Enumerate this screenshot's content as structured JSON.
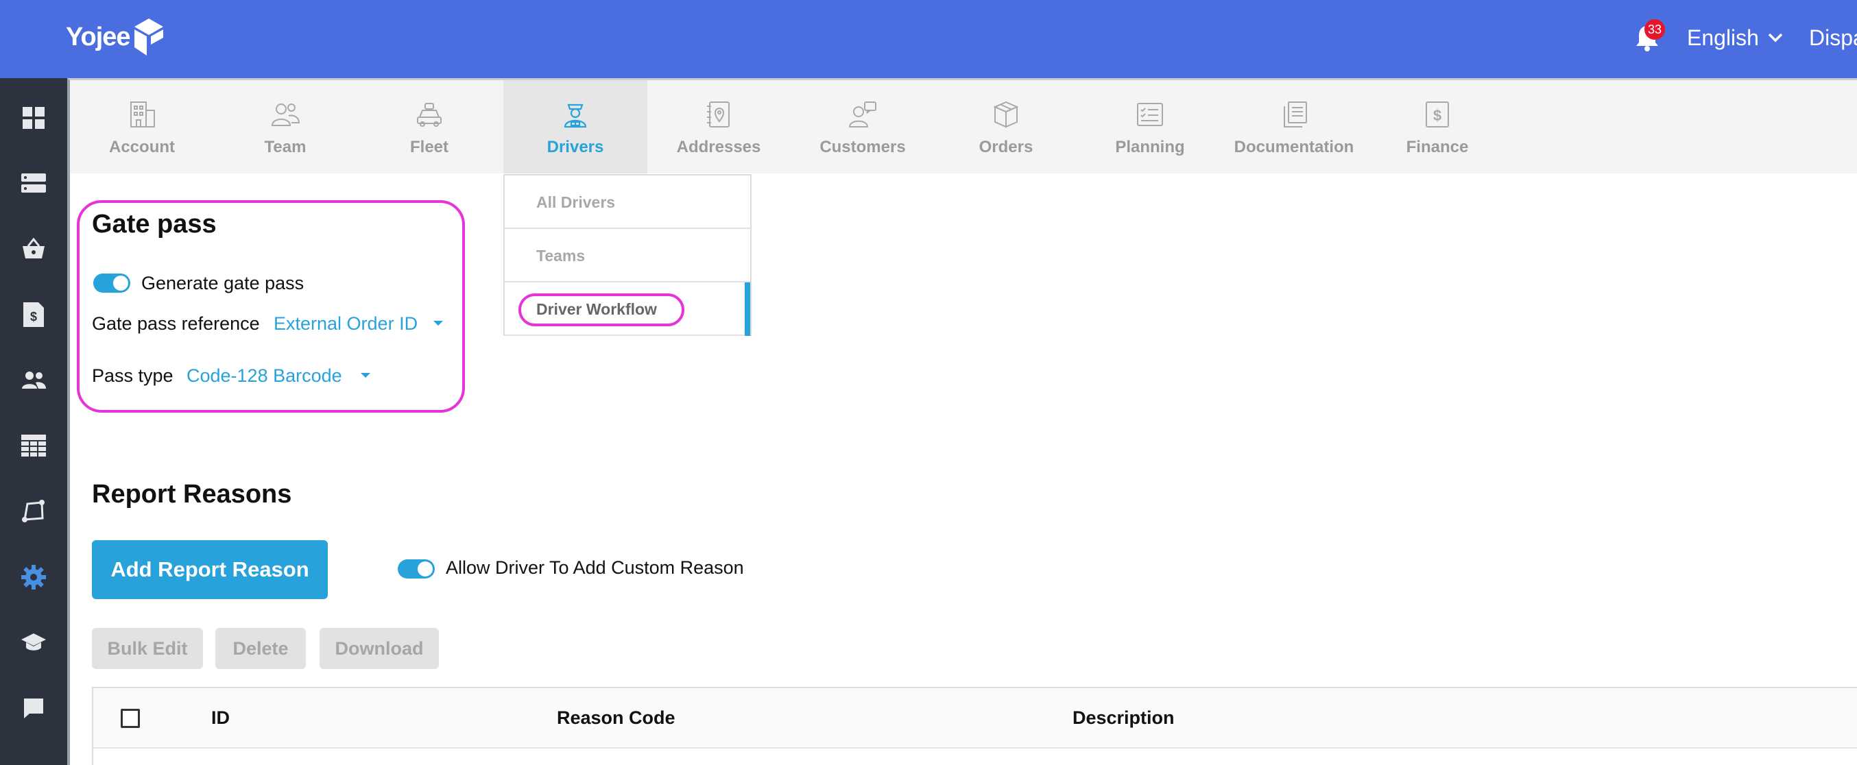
{
  "header": {
    "brand": "Yojee",
    "notification_count": "33",
    "language": "English",
    "dispatch_label": "Dispatch"
  },
  "sidebar": {
    "items": [
      {
        "icon": "dashboard-icon"
      },
      {
        "icon": "list-icon"
      },
      {
        "icon": "basket-icon"
      },
      {
        "icon": "invoice-icon"
      },
      {
        "icon": "people-icon"
      },
      {
        "icon": "table-icon"
      },
      {
        "icon": "route-icon"
      },
      {
        "icon": "gear-icon",
        "active": true
      },
      {
        "icon": "graduation-cap-icon"
      },
      {
        "icon": "chat-icon"
      }
    ]
  },
  "tabs": [
    {
      "label": "Account",
      "icon": "building-icon"
    },
    {
      "label": "Team",
      "icon": "team-icon"
    },
    {
      "label": "Fleet",
      "icon": "truck-icon"
    },
    {
      "label": "Drivers",
      "icon": "driver-icon",
      "active": true
    },
    {
      "label": "Addresses",
      "icon": "address-book-icon"
    },
    {
      "label": "Customers",
      "icon": "customer-icon"
    },
    {
      "label": "Orders",
      "icon": "box-icon"
    },
    {
      "label": "Planning",
      "icon": "planning-icon"
    },
    {
      "label": "Documentation",
      "icon": "documents-icon"
    },
    {
      "label": "Finance",
      "icon": "dollar-icon"
    }
  ],
  "drivers_menu": {
    "items": [
      {
        "label": "All Drivers"
      },
      {
        "label": "Teams"
      },
      {
        "label": "Driver Workflow",
        "active": true
      }
    ]
  },
  "gate_pass": {
    "title": "Gate pass",
    "generate_label": "Generate gate pass",
    "generate_enabled": true,
    "reference_label": "Gate pass reference",
    "reference_value": "External Order ID",
    "pass_type_label": "Pass type",
    "pass_type_value": "Code-128 Barcode"
  },
  "report_reasons": {
    "title": "Report Reasons",
    "add_button": "Add Report Reason",
    "custom_reason_label": "Allow Driver To Add Custom Reason",
    "custom_reason_enabled": true,
    "bulk_edit": "Bulk Edit",
    "delete": "Delete",
    "download": "Download",
    "columns": [
      "ID",
      "Reason Code",
      "Description"
    ]
  },
  "colors": {
    "header": "#4a6ee0",
    "sidebar": "#2c323e",
    "accent": "#27a2db",
    "highlight": "#e535d6"
  }
}
